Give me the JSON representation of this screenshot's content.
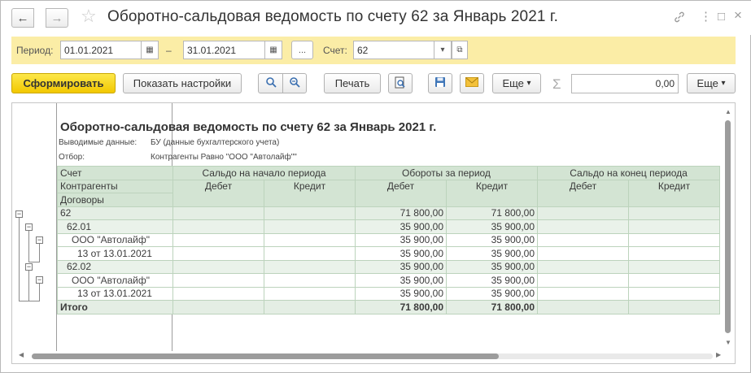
{
  "window": {
    "title": "Оборотно-сальдовая ведомость по счету 62 за Январь 2021 г.",
    "back_icon": "←",
    "forward_icon": "→",
    "star_icon": "☆",
    "link_icon": "🔗",
    "menu_icon": "⋮",
    "maximize_icon": "□",
    "close_icon": "×"
  },
  "period": {
    "label": "Период:",
    "start": "01.01.2021",
    "dash": "–",
    "end": "31.01.2021",
    "calendar_icon": "▦",
    "dots_label": "...",
    "account_label": "Счет:",
    "account_value": "62",
    "dropdown_icon": "▾",
    "open_icon": "⧉"
  },
  "toolbar": {
    "generate": "Сформировать",
    "show_settings": "Показать настройки",
    "search_icon": "🔍",
    "search_next_icon": "⟳",
    "print": "Печать",
    "preview_icon": "🔍",
    "save_icon": "💾",
    "mail_icon": "✉",
    "more1": "Еще",
    "more_arrow": "▾",
    "sigma": "Σ",
    "sum_value": "0,00",
    "more2": "Еще"
  },
  "report": {
    "title": "Оборотно-сальдовая ведомость по счету 62 за Январь 2021 г.",
    "output_label": "Выводимые данные:",
    "output_value": "БУ (данные бухгалтерского учета)",
    "filter_label": "Отбор:",
    "filter_value": "Контрагенты Равно \"ООО \"Автолайф\"\"",
    "headers": {
      "account": "Счет",
      "counterparties": "Контрагенты",
      "contracts": "Договоры",
      "opening": "Сальдо на начало периода",
      "turnover": "Обороты за период",
      "closing": "Сальдо на конец периода",
      "debit": "Дебет",
      "credit": "Кредит"
    },
    "rows": [
      {
        "name": "62",
        "ob_debit": "71 800,00",
        "ob_credit": "71 800,00"
      },
      {
        "name": "62.01",
        "ob_debit": "35 900,00",
        "ob_credit": "35 900,00"
      },
      {
        "name": "ООО \"Автолайф\"",
        "ob_debit": "35 900,00",
        "ob_credit": "35 900,00"
      },
      {
        "name": "13 от 13.01.2021",
        "ob_debit": "35 900,00",
        "ob_credit": "35 900,00"
      },
      {
        "name": "62.02",
        "ob_debit": "35 900,00",
        "ob_credit": "35 900,00"
      },
      {
        "name": "ООО \"Автолайф\"",
        "ob_debit": "35 900,00",
        "ob_credit": "35 900,00"
      },
      {
        "name": "13 от 13.01.2021",
        "ob_debit": "35 900,00",
        "ob_credit": "35 900,00"
      }
    ],
    "total": {
      "name": "Итого",
      "ob_debit": "71 800,00",
      "ob_credit": "71 800,00"
    },
    "collapse_glyph": "−"
  }
}
